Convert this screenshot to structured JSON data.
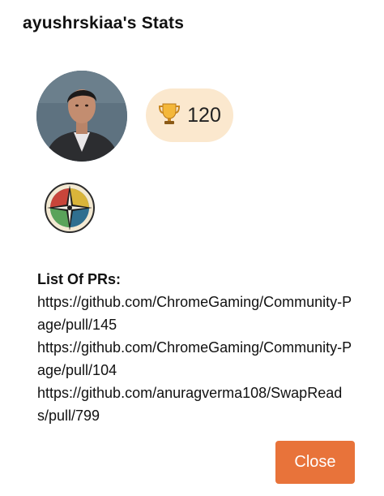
{
  "modal": {
    "title": "ayushrskiaa's Stats",
    "points": {
      "icon": "trophy-icon",
      "value": "120",
      "pill_color": "#fbe8ce"
    },
    "prs": {
      "heading": "List Of PRs:",
      "links": [
        "https://github.com/ChromeGaming/Community-Page/pull/145",
        "https://github.com/ChromeGaming/Community-Page/pull/104",
        "https://github.com/anuragverma108/SwapReads/pull/799"
      ]
    },
    "close_button": {
      "label": "Close",
      "color": "#e8733a"
    }
  }
}
